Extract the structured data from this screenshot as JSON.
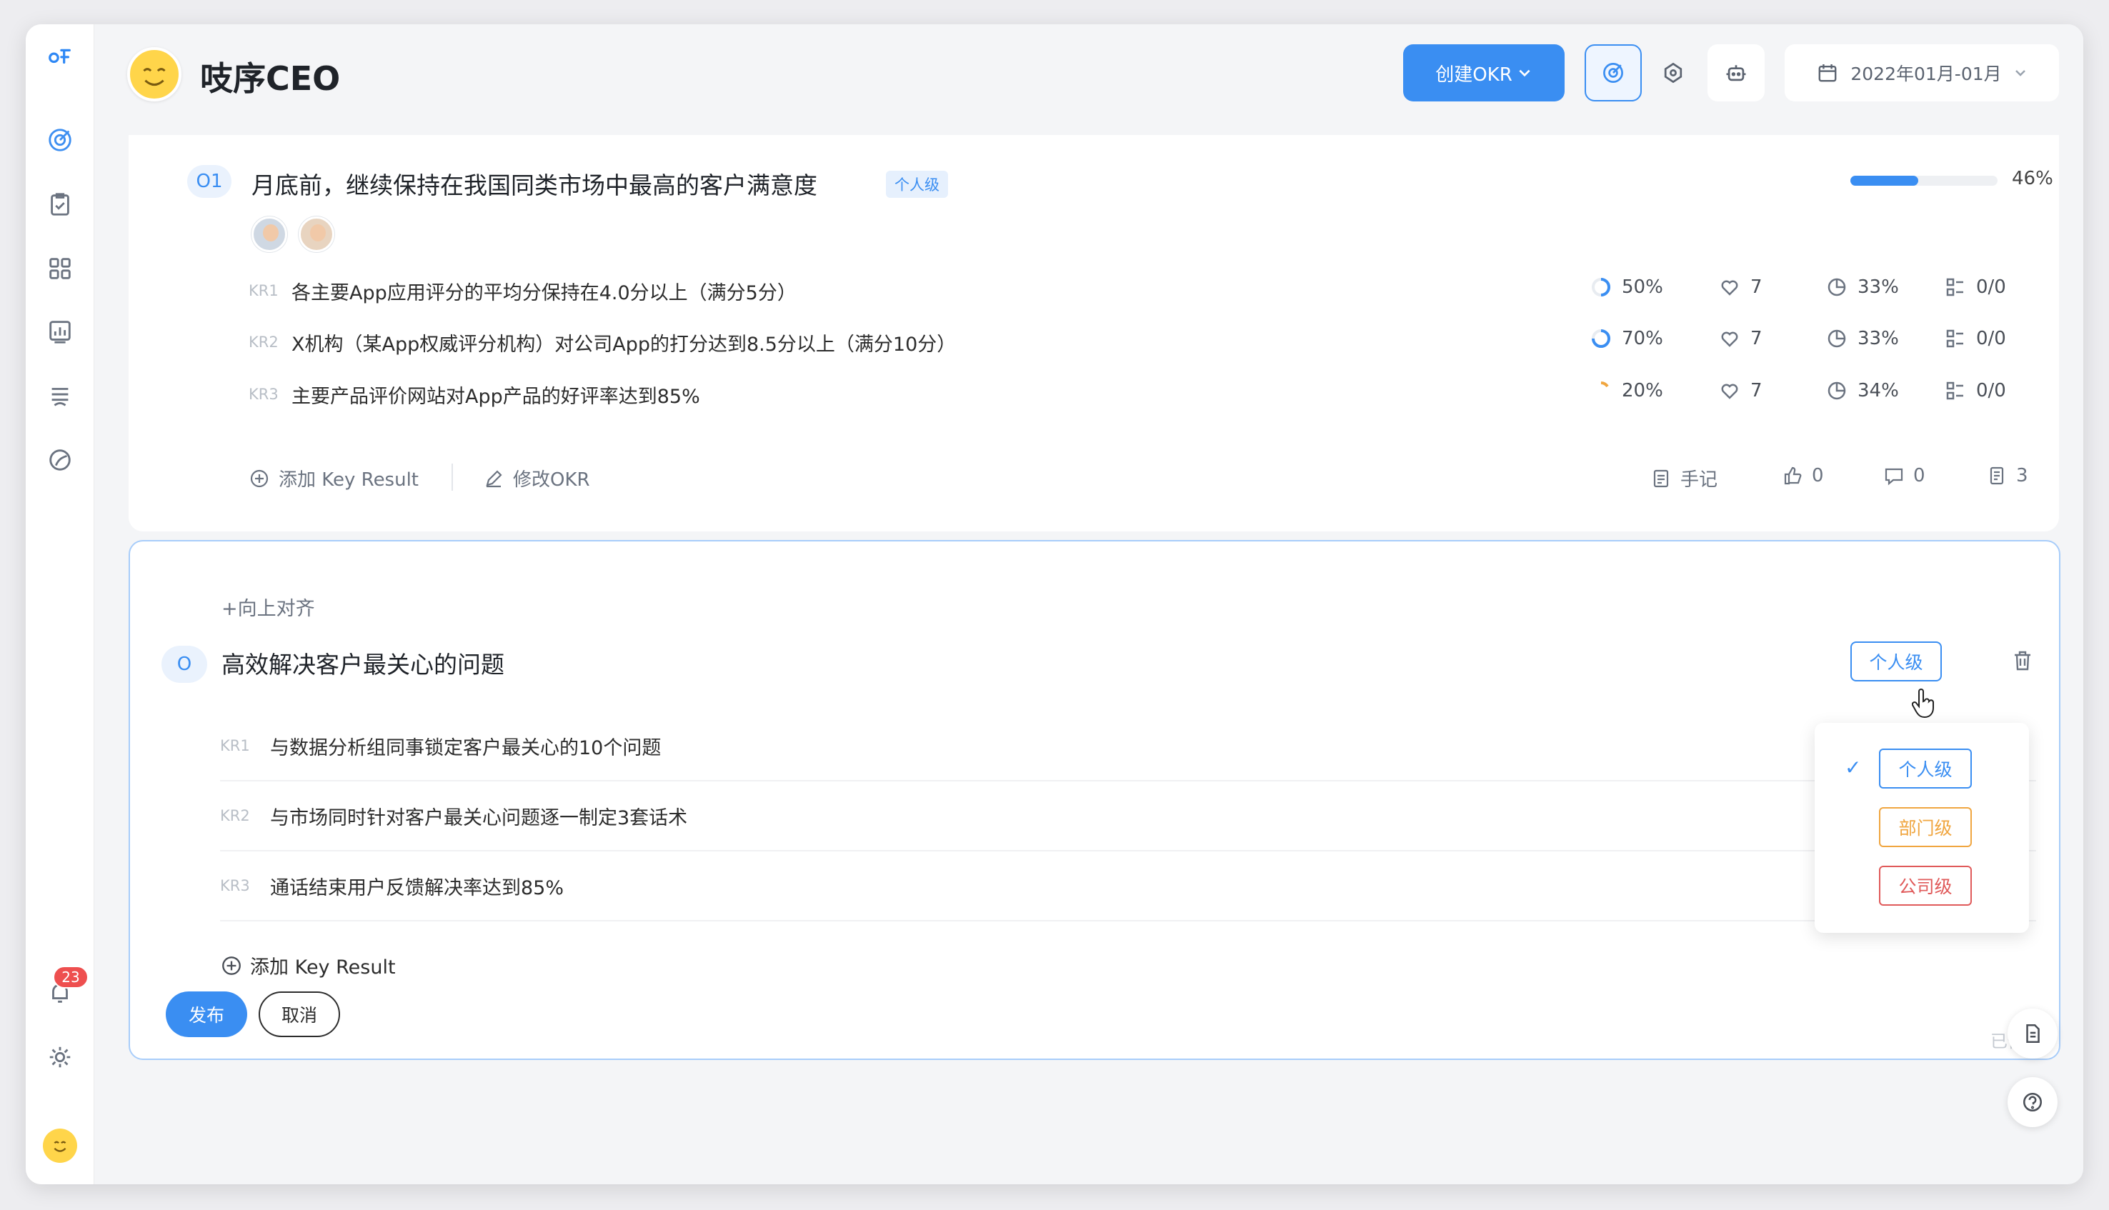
{
  "header": {
    "title": "吱序CEO",
    "create_label": "创建OKR",
    "date_label": "2022年01月-01月"
  },
  "sidebar": {
    "notification_count": "23"
  },
  "objective1": {
    "number": "O1",
    "title": "月底前，继续保持在我国同类市场中最高的客户满意度",
    "level_tag": "个人级",
    "progress": 46,
    "progress_text": "46%",
    "key_results": [
      {
        "label": "KR1",
        "text": "各主要App应用评分的平均分保持在4.0分以上（满分5分）",
        "progress": "50%",
        "likes": "7",
        "confidence": "33%",
        "tasks": "0/0"
      },
      {
        "label": "KR2",
        "text": "X机构（某App权威评分机构）对公司App的打分达到8.5分以上（满分10分）",
        "progress": "70%",
        "likes": "7",
        "confidence": "33%",
        "tasks": "0/0"
      },
      {
        "label": "KR3",
        "text": "主要产品评价网站对App产品的好评率达到85%",
        "progress": "20%",
        "likes": "7",
        "confidence": "34%",
        "tasks": "0/0"
      }
    ],
    "actions": {
      "add_kr": "添加 Key Result",
      "edit_okr": "修改OKR",
      "notes": "手记",
      "likes": "0",
      "comments": "0",
      "docs": "3"
    }
  },
  "objective2": {
    "align_up": "+向上对齐",
    "number": "O",
    "title": "高效解决客户最关心的问题",
    "level_button": "个人级",
    "key_results": [
      {
        "label": "KR1",
        "text": "与数据分析组同事锁定客户最关心的10个问题"
      },
      {
        "label": "KR2",
        "text": "与市场同时针对客户最关心问题逐一制定3套话术"
      },
      {
        "label": "KR3",
        "text": "通话结束用户反馈解决率达到85%"
      }
    ],
    "add_kr": "添加 Key Result",
    "publish": "发布",
    "cancel": "取消",
    "saved": "已保存"
  },
  "level_dropdown": {
    "options": [
      {
        "label": "个人级",
        "color": "#3a8ef2",
        "selected": true
      },
      {
        "label": "部门级",
        "color": "#f0a640",
        "selected": false
      },
      {
        "label": "公司级",
        "color": "#e05a5a",
        "selected": false
      }
    ]
  },
  "colors": {
    "accent": "#3a8ef2",
    "department": "#f0a640",
    "company": "#e05a5a"
  }
}
